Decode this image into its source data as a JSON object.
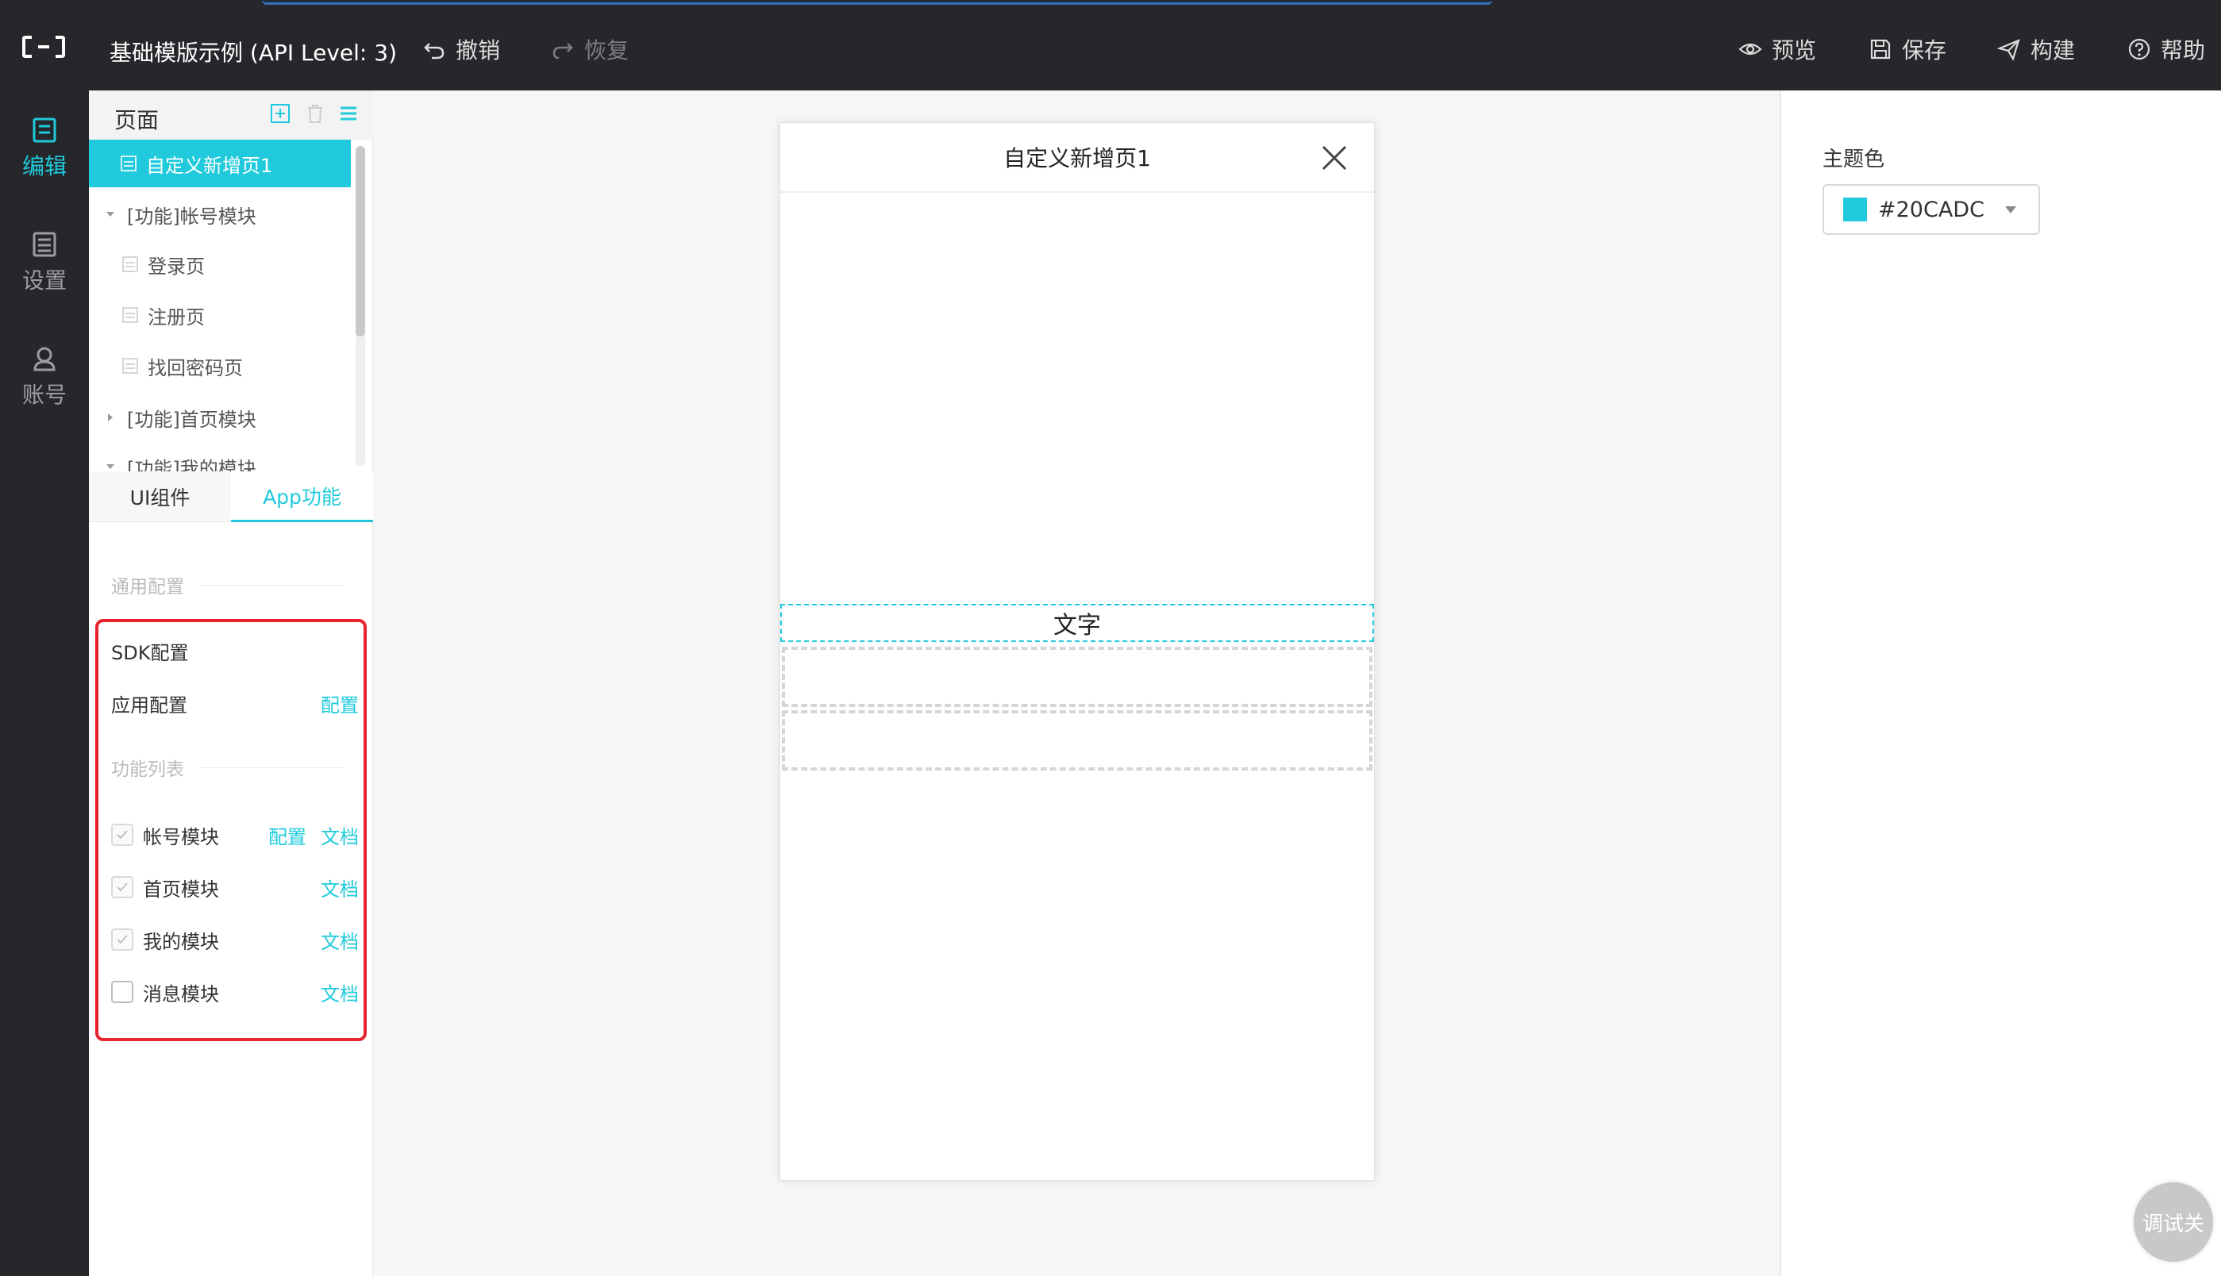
{
  "app": {
    "title": "基础模版示例 (API Level: 3)",
    "accent_color": "#20CADC",
    "logo_icon": "bracket-logo-icon"
  },
  "toolbar": {
    "undo_label": "撤销",
    "redo_label": "恢复",
    "preview_label": "预览",
    "save_label": "保存",
    "build_label": "构建",
    "help_label": "帮助"
  },
  "leftnav": {
    "items": [
      {
        "label": "编辑",
        "icon": "edit-icon",
        "active": true
      },
      {
        "label": "设置",
        "icon": "settings-list-icon",
        "active": false
      },
      {
        "label": "账号",
        "icon": "user-icon",
        "active": false
      }
    ]
  },
  "pages_panel": {
    "title": "页面",
    "actions": [
      "add-page-icon",
      "delete-page-icon",
      "menu-icon"
    ],
    "tree": [
      {
        "label": "自定义新增页1",
        "selected": true
      },
      {
        "label": "[功能]帐号模块",
        "expanded": true
      },
      {
        "label": "登录页"
      },
      {
        "label": "注册页"
      },
      {
        "label": "找回密码页"
      },
      {
        "label": "[功能]首页模块",
        "expanded": false
      },
      {
        "label": "[功能]我的模块",
        "expanded": true
      }
    ]
  },
  "component_panel": {
    "tabs": [
      {
        "label": "UI组件",
        "active": false
      },
      {
        "label": "App功能",
        "active": true
      }
    ],
    "general_section": "通用配置",
    "sdk_config": "SDK配置",
    "app_config": "应用配置",
    "config_link": "配置",
    "feature_section": "功能列表",
    "doc_link": "文档",
    "features": [
      {
        "label": "帐号模块",
        "checked": true,
        "has_config": true
      },
      {
        "label": "首页模块",
        "checked": true,
        "has_config": false
      },
      {
        "label": "我的模块",
        "checked": true,
        "has_config": false
      },
      {
        "label": "消息模块",
        "checked": false,
        "has_config": false
      }
    ]
  },
  "phone": {
    "title": "自定义新增页1",
    "text_widget": "文字"
  },
  "right_panel": {
    "theme_label": "主题色",
    "theme_value": "#20CADC",
    "theme_text": "#20CADC"
  },
  "debug_button": "调试关"
}
